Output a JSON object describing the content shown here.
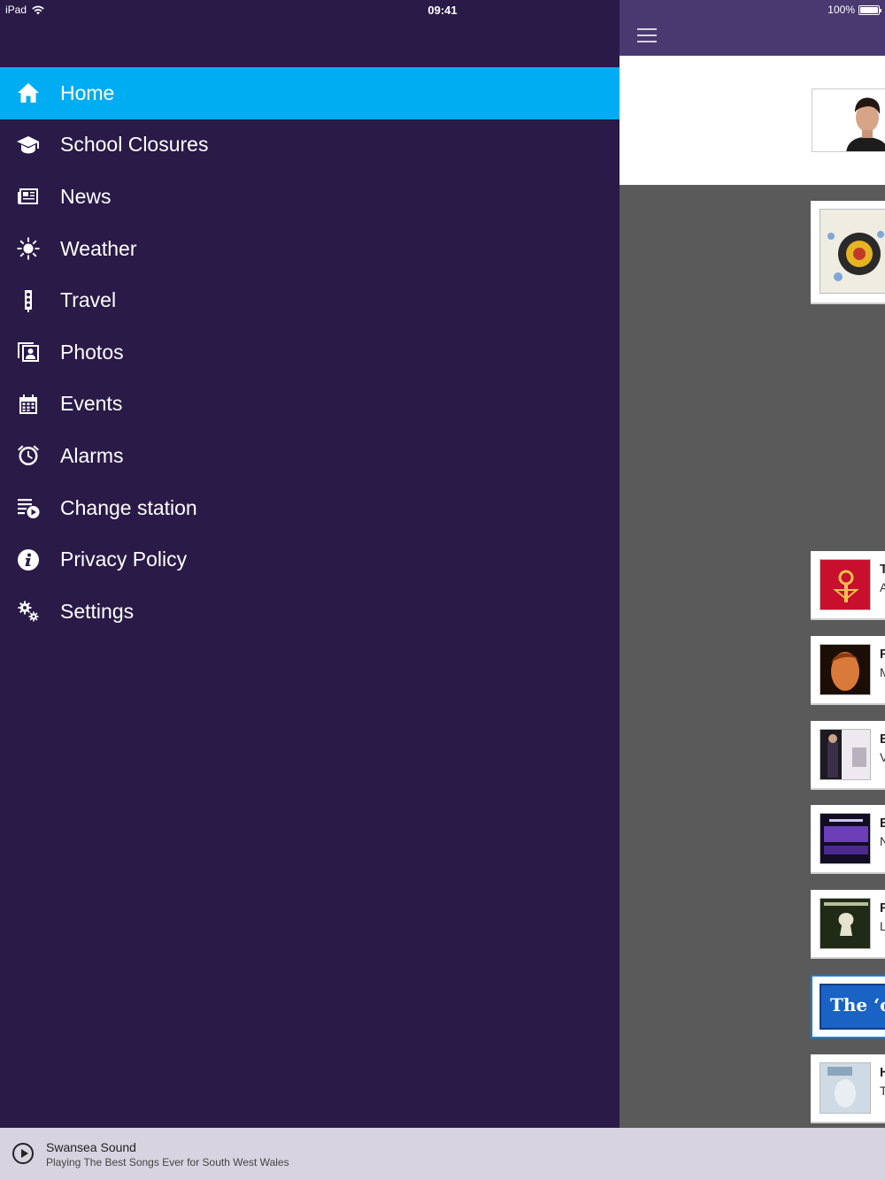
{
  "status_bar": {
    "device": "iPad",
    "time": "09:41",
    "battery": "100%"
  },
  "menu": {
    "items": [
      {
        "label": "Home",
        "icon": "home-icon",
        "active": true
      },
      {
        "label": "School Closures",
        "icon": "graduation-cap-icon",
        "active": false
      },
      {
        "label": "News",
        "icon": "newspaper-icon",
        "active": false
      },
      {
        "label": "Weather",
        "icon": "sun-icon",
        "active": false
      },
      {
        "label": "Travel",
        "icon": "traffic-light-icon",
        "active": false
      },
      {
        "label": "Photos",
        "icon": "photos-icon",
        "active": false
      },
      {
        "label": "Events",
        "icon": "calendar-icon",
        "active": false
      },
      {
        "label": "Alarms",
        "icon": "alarm-clock-icon",
        "active": false
      },
      {
        "label": "Change station",
        "icon": "playlist-play-icon",
        "active": false
      },
      {
        "label": "Privacy Policy",
        "icon": "info-icon",
        "active": false
      },
      {
        "label": "Settings",
        "icon": "gears-icon",
        "active": false
      }
    ],
    "active_color": "#00adf2",
    "background_color": "#2a1a48"
  },
  "content": {
    "recent_tracks": [
      {
        "title_initial": "T",
        "artist_initial": "A"
      },
      {
        "title_initial": "F",
        "artist_initial": "M"
      },
      {
        "title_initial": "E",
        "artist_initial": "V"
      },
      {
        "title_initial": "E",
        "artist_initial": "N"
      },
      {
        "title_initial": "F",
        "artist_initial": "L"
      }
    ],
    "banner_text": "The ‘on",
    "last_track": {
      "title_initial": "H",
      "artist_initial": "T"
    }
  },
  "player": {
    "station": "Swansea Sound",
    "tagline": "Playing The Best Songs Ever for South West Wales"
  }
}
